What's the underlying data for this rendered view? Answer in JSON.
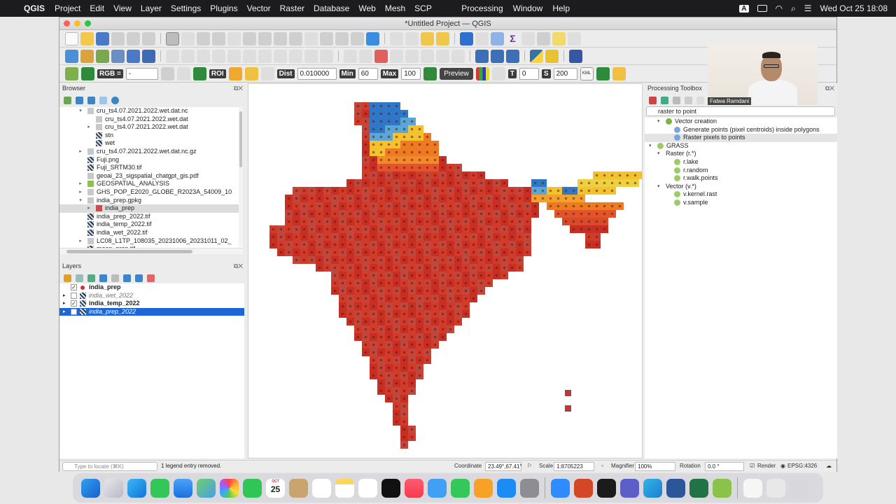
{
  "menubar": {
    "app": "QGIS",
    "items": [
      "Project",
      "Edit",
      "View",
      "Layer",
      "Settings",
      "Plugins",
      "Vector",
      "Raster",
      "Database",
      "Web",
      "Mesh",
      "SCP"
    ],
    "right_items": [
      "Processing",
      "Window",
      "Help"
    ],
    "input_badge": "A",
    "datetime": "Wed Oct 25  18:08"
  },
  "window": {
    "title": "*Untitled Project — QGIS"
  },
  "scp": {
    "rgb_label": "RGB =",
    "rgb_value": "-",
    "roi_label": "ROI",
    "dist_label": "Dist",
    "dist_value": "0.010000",
    "min_label": "Min",
    "min_value": "60",
    "max_label": "Max",
    "max_value": "100",
    "preview_label": "Preview",
    "t_label": "T",
    "t_value": "0",
    "s_label": "S",
    "s_value": "200"
  },
  "browser": {
    "title": "Browser",
    "items": [
      {
        "label": "cru_ts4.07.2021.2022.wet.dat.nc",
        "indent": 1,
        "arrow": "▾",
        "icon": "file-icon"
      },
      {
        "label": "cru_ts4.07.2021.2022.wet.dat",
        "indent": 2,
        "arrow": "",
        "icon": "file-icon"
      },
      {
        "label": "cru_ts4.07.2021.2022.wet.dat",
        "indent": 2,
        "arrow": "▸",
        "icon": "file-icon"
      },
      {
        "label": "stn",
        "indent": 2,
        "arrow": "",
        "icon": "raster-icon"
      },
      {
        "label": "wet",
        "indent": 2,
        "arrow": "",
        "icon": "raster-icon"
      },
      {
        "label": "cru_ts4.07.2021.2022.wet.dat.nc.gz",
        "indent": 1,
        "arrow": "▸",
        "icon": "file-icon"
      },
      {
        "label": "Fuji.png",
        "indent": 1,
        "arrow": "",
        "icon": "raster-icon"
      },
      {
        "label": "Fuji_SRTM30.tif",
        "indent": 1,
        "arrow": "",
        "icon": "raster-icon"
      },
      {
        "label": "geoai_23_sigspatial_chatgpt_gis.pdf",
        "indent": 1,
        "arrow": "",
        "icon": "file-icon"
      },
      {
        "label": "GEOSPATIAL_ANALYSIS",
        "indent": 1,
        "arrow": "▸",
        "icon": "qgs-icon"
      },
      {
        "label": "GHS_POP_E2020_GLOBE_R2023A_54009_10",
        "indent": 1,
        "arrow": "▸",
        "icon": "file-icon"
      },
      {
        "label": "india_prep.gpkg",
        "indent": 1,
        "arrow": "▾",
        "icon": "file-icon"
      },
      {
        "label": "india_prep",
        "indent": 2,
        "arrow": "▸",
        "icon": "point-icon"
      },
      {
        "label": "india_prep_2022.tif",
        "indent": 1,
        "arrow": "",
        "icon": "raster-icon"
      },
      {
        "label": "india_temp_2022.tif",
        "indent": 1,
        "arrow": "",
        "icon": "raster-icon"
      },
      {
        "label": "india_wet_2022.tif",
        "indent": 1,
        "arrow": "",
        "icon": "raster-icon"
      },
      {
        "label": "LC08_L1TP_108035_20231006_20231011_02_",
        "indent": 1,
        "arrow": "▸",
        "icon": "file-icon"
      },
      {
        "label": "mean_prep.tif",
        "indent": 1,
        "arrow": "",
        "icon": "raster-icon"
      }
    ]
  },
  "layers": {
    "title": "Layers",
    "items": [
      {
        "label": "india_prep",
        "checked": "✓",
        "bold": true,
        "italic": false,
        "icon": "point-icon",
        "arrow": "",
        "selected": false
      },
      {
        "label": "india_wet_2022",
        "checked": "",
        "bold": false,
        "italic": true,
        "icon": "raster-icon",
        "arrow": "▸",
        "selected": false
      },
      {
        "label": "india_temp_2022",
        "checked": "✓",
        "bold": true,
        "italic": false,
        "icon": "raster-icon",
        "arrow": "▸",
        "selected": false
      },
      {
        "label": "india_prep_2022",
        "checked": "",
        "bold": false,
        "italic": true,
        "icon": "raster-icon",
        "arrow": "▸",
        "selected": true
      }
    ]
  },
  "processing": {
    "title": "Processing Toolbox",
    "search_value": "raster to point",
    "items": [
      {
        "label": "Vector creation",
        "arrow": "▾",
        "indent": 0,
        "icon": "qgis-icon",
        "hl": false
      },
      {
        "label": "Generate points (pixel centroids) inside polygons",
        "arrow": "",
        "indent": 1,
        "icon": "gear-icon",
        "hl": false
      },
      {
        "label": "Raster pixels to points",
        "arrow": "",
        "indent": 1,
        "icon": "gear-icon",
        "hl": true
      },
      {
        "label": "GRASS",
        "arrow": "▾",
        "indent": -1,
        "icon": "grass-icon",
        "hl": false
      },
      {
        "label": "Raster (r.*)",
        "arrow": "▾",
        "indent": 0,
        "icon": "",
        "hl": false
      },
      {
        "label": "r.lake",
        "arrow": "",
        "indent": 1,
        "icon": "grass-icon",
        "hl": false
      },
      {
        "label": "r.random",
        "arrow": "",
        "indent": 1,
        "icon": "grass-icon",
        "hl": false
      },
      {
        "label": "r.walk.points",
        "arrow": "",
        "indent": 1,
        "icon": "grass-icon",
        "hl": false
      },
      {
        "label": "Vector (v.*)",
        "arrow": "▾",
        "indent": 0,
        "icon": "",
        "hl": false
      },
      {
        "label": "v.kernel.rast",
        "arrow": "",
        "indent": 1,
        "icon": "grass-icon",
        "hl": false
      },
      {
        "label": "v.sample",
        "arrow": "",
        "indent": 1,
        "icon": "grass-icon",
        "hl": false
      }
    ]
  },
  "webcam": {
    "name": "Fatwa Ramdani"
  },
  "statusbar": {
    "locate_placeholder": "Type to locate (⌘K)",
    "message": "1 legend entry removed.",
    "coordinate_label": "Coordinate",
    "coordinate_value": "23.49°,67.41°",
    "scale_label": "Scale",
    "scale_value": "1:8705223",
    "magnifier_label": "Magnifier",
    "magnifier_value": "100%",
    "rotation_label": "Rotation",
    "rotation_value": "0.0 °",
    "render_label": "Render",
    "crs_label": "EPSG:4326"
  },
  "dock": {
    "calendar_month": "OCT",
    "calendar_day": "25"
  },
  "colors": {
    "selection": "#1c66d6",
    "raster_high": "#d42a20",
    "raster_mid": "#f3c22e",
    "raster_low": "#2f78c8"
  }
}
